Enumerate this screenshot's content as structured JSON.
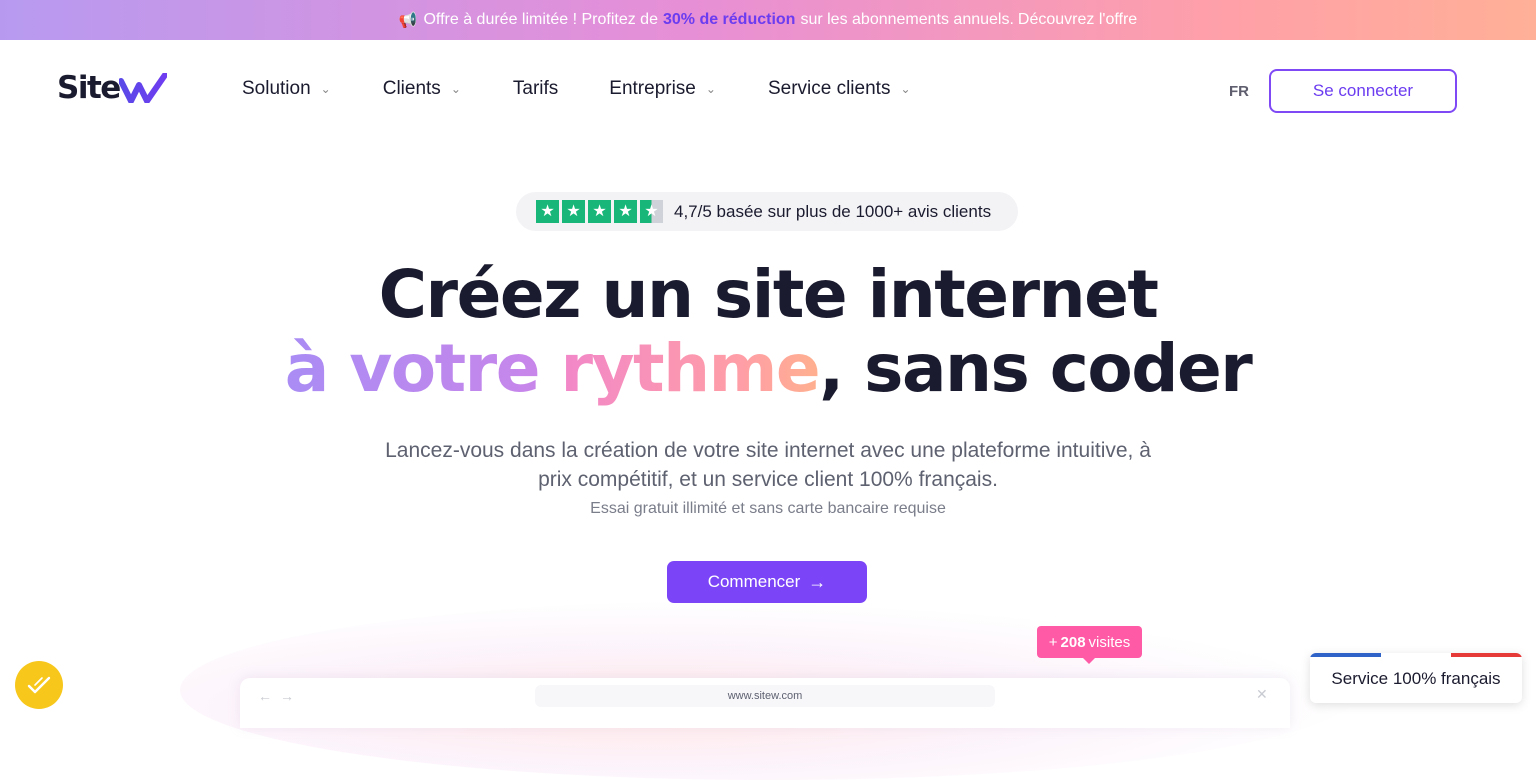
{
  "promo": {
    "icon": "megaphone-icon",
    "prefix": "Offre à durée limitée ! Profitez de",
    "highlight": "30% de réduction",
    "suffix": "sur les abonnements annuels.",
    "link": "Découvrez l'offre"
  },
  "nav": {
    "logo": "Site",
    "menu": [
      {
        "label": "Solution",
        "dropdown": true
      },
      {
        "label": "Clients",
        "dropdown": true
      },
      {
        "label": "Tarifs",
        "dropdown": false
      },
      {
        "label": "Entreprise",
        "dropdown": true
      },
      {
        "label": "Service clients",
        "dropdown": true
      }
    ],
    "lang": "FR",
    "login": "Se connecter"
  },
  "hero": {
    "rating_text": "4,7/5 basée sur plus de 1000+ avis clients",
    "rating_stars": 4.5,
    "title_line1": "Créez un site internet",
    "title_line2_part1": "à votre",
    "title_line2_part2": "rythme",
    "title_line2_part3": ", sans coder",
    "subtitle_line1": "Lancez-vous dans la création de votre site internet avec une plateforme intuitive, à",
    "subtitle_line2": "prix compétitif, et un service client 100% français.",
    "trial_note": "Essai gratuit illimité et sans carte bancaire requise",
    "cta": "Commencer",
    "cta_icon": "arrow-right-icon"
  },
  "preview": {
    "url": "www.sitew.com",
    "visits_prefix": "+",
    "visits_count": "208",
    "visits_label": "visites"
  },
  "widgets": {
    "fab_icon": "sparkle-check-icon",
    "fr_badge": "Service 100% français",
    "flag_colors": [
      "#2f63c8",
      "#ffffff",
      "#e53a37"
    ]
  },
  "colors": {
    "accent": "#7b45f7",
    "star_green": "#18b779",
    "pink": "#ff5aa6",
    "fab_yellow": "#f7c71c"
  }
}
